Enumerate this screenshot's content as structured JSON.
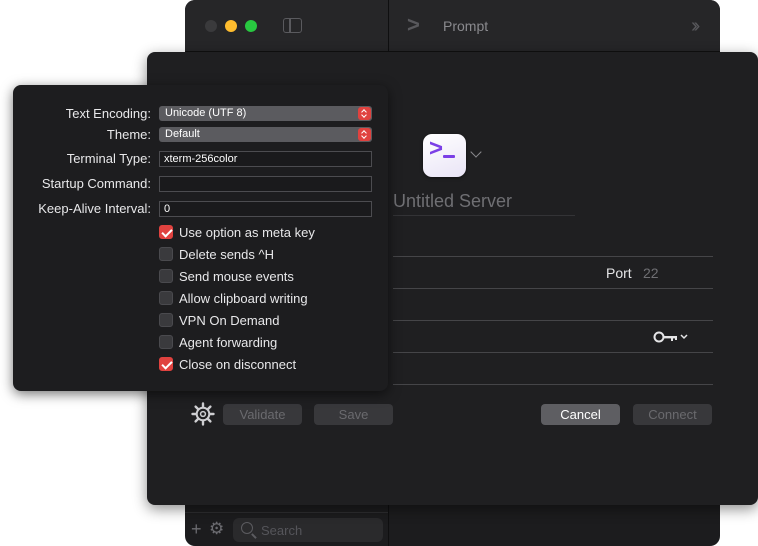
{
  "window": {
    "title": "Prompt",
    "search_placeholder": "Search"
  },
  "server": {
    "name_placeholder": "Untitled Server",
    "port_label": "Port",
    "port_value": "22"
  },
  "buttons": {
    "validate": "Validate",
    "save": "Save",
    "cancel": "Cancel",
    "connect": "Connect"
  },
  "advanced": {
    "text_encoding": {
      "label": "Text Encoding:",
      "value": "Unicode (UTF 8)"
    },
    "theme": {
      "label": "Theme:",
      "value": "Default"
    },
    "terminal_type": {
      "label": "Terminal Type:",
      "value": "xterm-256color"
    },
    "startup_command": {
      "label": "Startup Command:",
      "value": ""
    },
    "keep_alive": {
      "label": "Keep-Alive Interval:",
      "value": "0"
    },
    "options": [
      {
        "label": "Use option as meta key",
        "checked": true
      },
      {
        "label": "Delete sends ^H",
        "checked": false
      },
      {
        "label": "Send mouse events",
        "checked": false
      },
      {
        "label": "Allow clipboard writing",
        "checked": false
      },
      {
        "label": "VPN On Demand",
        "checked": false
      },
      {
        "label": "Agent forwarding",
        "checked": false
      },
      {
        "label": "Close on disconnect",
        "checked": true
      }
    ]
  },
  "colors": {
    "accent": "#e0423f",
    "app_icon_purple": "#7b3fe6"
  },
  "icons": {
    "prompt_logo": "prompt-chevron-icon",
    "sidebar": "sidebar-toggle-icon",
    "expand": "double-chevron-right-icon",
    "key": "key-icon",
    "settings": "gear-icon"
  }
}
